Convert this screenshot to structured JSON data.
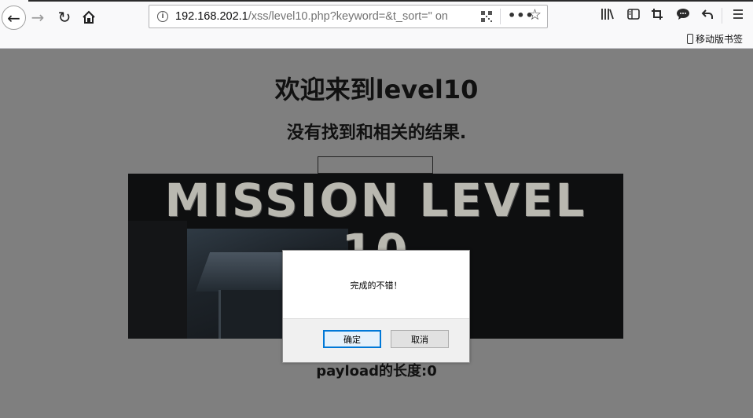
{
  "browser": {
    "url_host": "192.168.202.1",
    "url_rest": "/xss/level10.php?keyword=&t_sort=\" on",
    "bookmark_label": "移动版书签",
    "icons": {
      "back": "back-arrow-icon",
      "forward": "forward-arrow-icon",
      "reload": "reload-icon",
      "home": "home-icon",
      "info": "info-icon",
      "qr": "qr-code-icon",
      "more": "more-icon",
      "star": "bookmark-star-icon",
      "library": "library-icon",
      "sidebar": "sidebar-icon",
      "crop": "screenshot-icon",
      "chat": "chat-icon",
      "undo": "undo-icon",
      "menu": "hamburger-menu-icon"
    }
  },
  "page": {
    "heading": "欢迎来到level10",
    "result_text": "没有找到和相关的结果.",
    "banner_text": "MISSION LEVEL 10",
    "payload_text": "payload的长度:0"
  },
  "dialog": {
    "message": "完成的不错！",
    "ok_label": "确定",
    "cancel_label": "取消"
  },
  "colors": {
    "overlay_gray": "#7f7f7f",
    "ok_border": "#0078d7"
  }
}
